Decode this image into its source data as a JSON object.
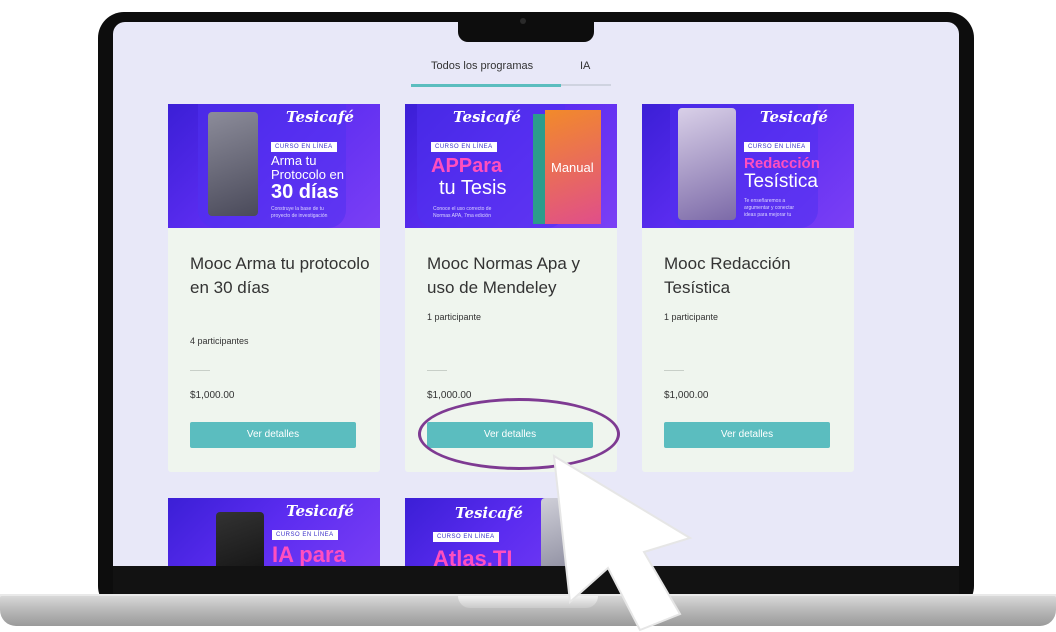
{
  "tabs": [
    {
      "label": "Todos los programas"
    },
    {
      "label": "IA"
    }
  ],
  "cards": [
    {
      "title": "Mooc Arma tu protocolo en 30 días",
      "participants": "4 participantes",
      "price": "$1,000.00",
      "button": "Ver detalles",
      "image": {
        "brand": "Tesicafé",
        "pill": "CURSO EN LÍNEA",
        "line1": "Arma tu",
        "line2": "Protocolo en",
        "line3": "30 días",
        "copy1": "Construye la base de tu",
        "copy2": "proyecto de investigación"
      }
    },
    {
      "title": "Mooc Normas Apa y uso de Mendeley",
      "participants": "1 participante",
      "price": "$1,000.00",
      "button": "Ver detalles",
      "image": {
        "brand": "Tesicafé",
        "pill": "CURSO EN LÍNEA",
        "line1": "APPara",
        "line2": "tu Tesis",
        "copy1": "Conoce el uso correcto de",
        "copy2": "Normas APA, 7ma edición",
        "book": "Manual"
      }
    },
    {
      "title": "Mooc Redacción Tesística",
      "participants": "1 participante",
      "price": "$1,000.00",
      "button": "Ver detalles",
      "image": {
        "brand": "Tesicafé",
        "pill": "CURSO EN LÍNEA",
        "line1": "Redacción",
        "line2": "Tesística",
        "copy1": "Te enseñaremos a",
        "copy2": "argumentar y conectar",
        "copy3": "ideas para mejorar tu"
      }
    }
  ],
  "bottom_cards": [
    {
      "brand": "Tesicafé",
      "pill": "CURSO EN LÍNEA",
      "headline": "IA para"
    },
    {
      "brand": "Tesicafé",
      "pill": "CURSO EN LÍNEA",
      "headline": "Atlas.TI"
    }
  ],
  "colors": {
    "accent": "#5bbdbf",
    "highlight_ring": "#7e3a92",
    "screen_bg": "#e8e8f8",
    "card_bg": "#eff5ee",
    "banner": "#4b27e6"
  }
}
